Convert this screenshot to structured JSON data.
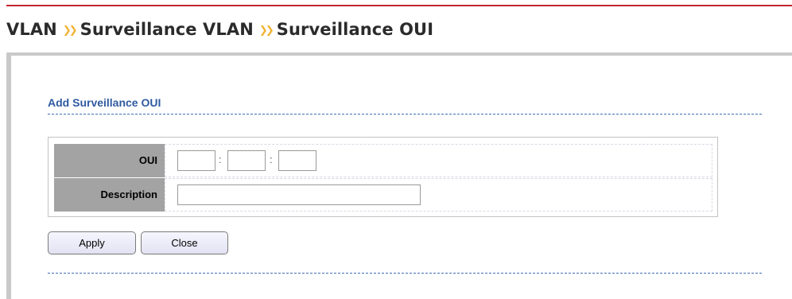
{
  "header": {
    "breadcrumb": [
      {
        "label": "VLAN"
      },
      {
        "label": "Surveillance VLAN"
      },
      {
        "label": "Surveillance OUI"
      }
    ],
    "separator": "❯❯"
  },
  "section": {
    "title": "Add Surveillance OUI"
  },
  "form": {
    "oui": {
      "label": "OUI",
      "parts": [
        "",
        "",
        ""
      ],
      "separator": ":"
    },
    "description": {
      "label": "Description",
      "value": ""
    }
  },
  "buttons": {
    "apply": "Apply",
    "close": "Close"
  },
  "colors": {
    "accent_top_rule": "#c0272d",
    "breadcrumb_separator": "#f2b233",
    "section_title": "#2f5aa0",
    "label_background": "#a3a3a3"
  }
}
